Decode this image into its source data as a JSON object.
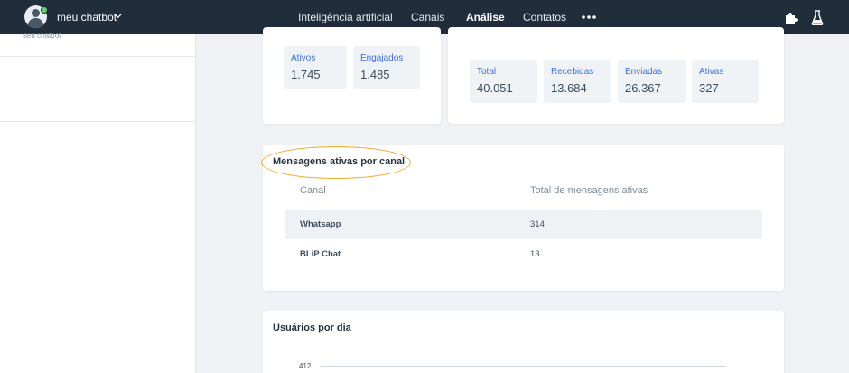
{
  "header": {
    "bot_name": "meu chatbot",
    "nav": [
      {
        "label": "Inteligência artificial"
      },
      {
        "label": "Canais"
      },
      {
        "label": "Análise"
      },
      {
        "label": "Contatos"
      }
    ],
    "active_nav": "Análise",
    "colors": {
      "bar": "#202d3b",
      "accent": "#2cc3d5",
      "online": "#61d36f"
    }
  },
  "sidebar": {
    "subtitle": "seu chatbot"
  },
  "users_card": {
    "stats": [
      {
        "label": "Ativos",
        "value": "1.745"
      },
      {
        "label": "Engajados",
        "value": "1.485"
      }
    ]
  },
  "messages_card": {
    "stats": [
      {
        "label": "Total",
        "value": "40.051"
      },
      {
        "label": "Recebidas",
        "value": "13.684"
      },
      {
        "label": "Enviadas",
        "value": "26.367"
      },
      {
        "label": "Ativas",
        "value": "327"
      }
    ]
  },
  "active_messages": {
    "title": "Mensagens ativas por canal",
    "columns": {
      "channel": "Canal",
      "total": "Total de mensagens ativas"
    },
    "rows": [
      {
        "channel": "Whatsapp",
        "total": "314"
      },
      {
        "channel": "BLiP Chat",
        "total": "13"
      }
    ]
  },
  "users_per_day": {
    "title": "Usuários por dia",
    "y_tick": "412"
  }
}
